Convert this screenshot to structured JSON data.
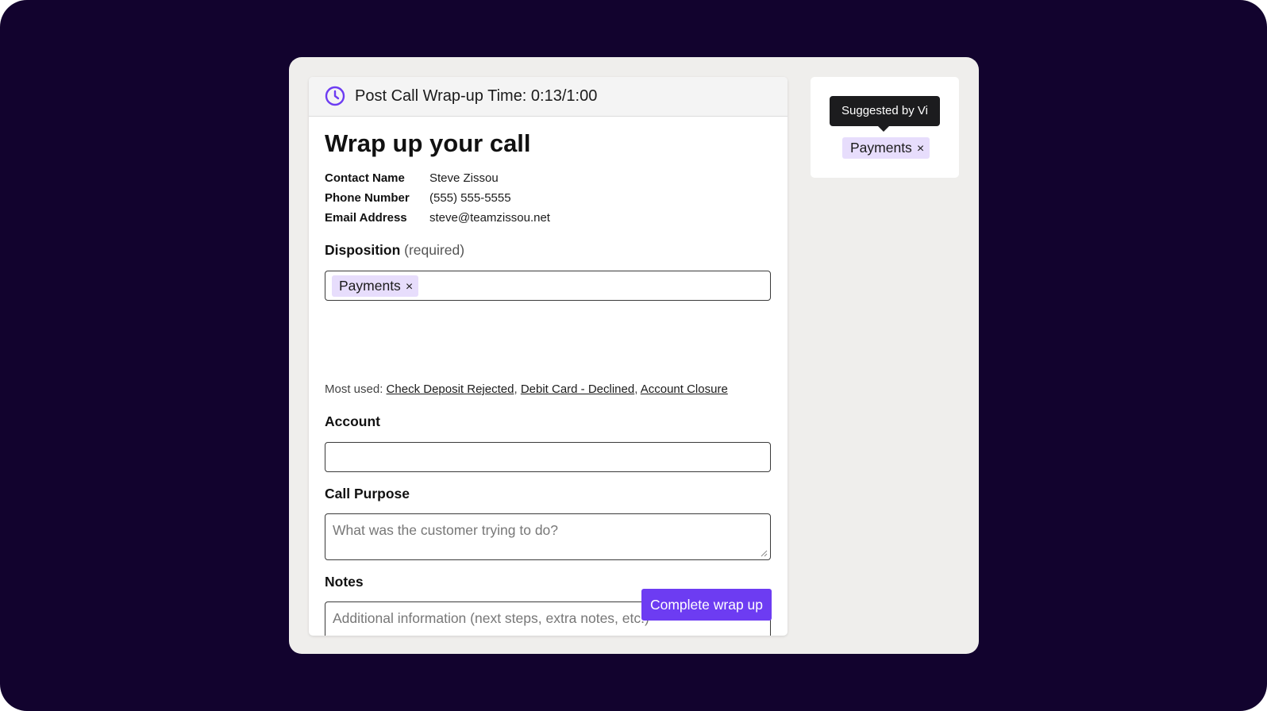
{
  "header": {
    "timer_text": "Post Call Wrap-up Time: 0:13/1:00",
    "icon": "clock-icon",
    "accent_color": "#6d3cf2"
  },
  "form": {
    "title": "Wrap up your call",
    "contact": [
      {
        "label": "Contact Name",
        "value": "Steve Zissou"
      },
      {
        "label": "Phone Number",
        "value": "(555) 555-5555"
      },
      {
        "label": "Email Address",
        "value": "steve@teamzissou.net"
      }
    ],
    "disposition": {
      "label": "Disposition",
      "required_note": "(required)",
      "selected_tag": "Payments",
      "remove_glyph": "×",
      "most_used_label": "Most used:",
      "most_used": [
        "Check Deposit Rejected",
        "Debit Card - Declined",
        "Account Closure"
      ],
      "separator": ","
    },
    "account": {
      "label": "Account",
      "value": ""
    },
    "call_purpose": {
      "label": "Call Purpose",
      "placeholder": "What was the customer trying to do?"
    },
    "notes": {
      "label": "Notes",
      "placeholder": "Additional information (next steps, extra notes, etc.)"
    },
    "submit_label": "Complete wrap up"
  },
  "suggestion": {
    "tooltip": "Suggested by Vi",
    "tag": "Payments",
    "remove_glyph": "×"
  },
  "colors": {
    "background": "#12032e",
    "panel": "#efeeec",
    "tag_bg": "#e7ddfc",
    "button": "#6d3cf2",
    "tooltip_bg": "#1c1c1e"
  }
}
